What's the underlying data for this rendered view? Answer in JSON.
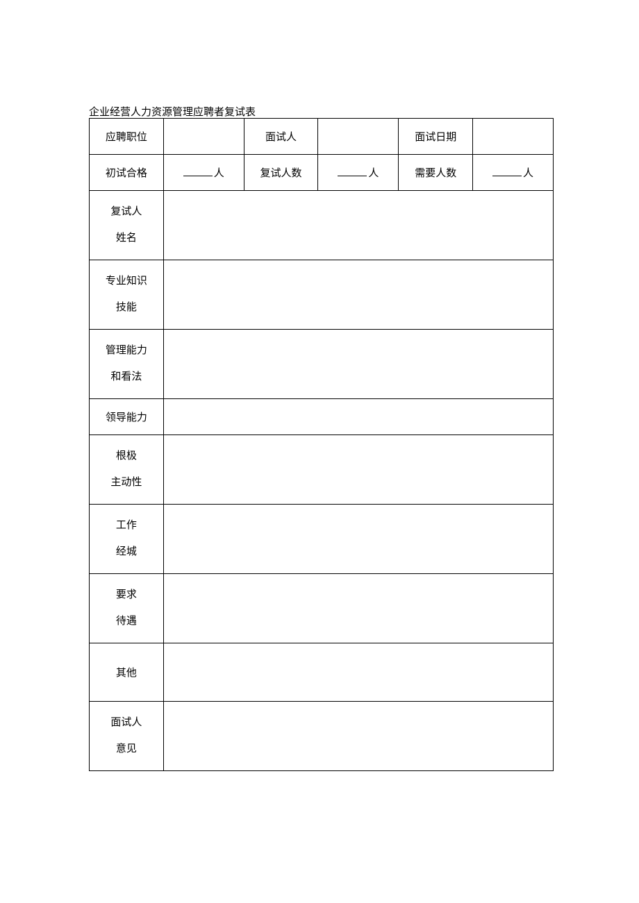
{
  "title": "企业经营人力资源管理应聘者复试表",
  "header": {
    "positionLabel": "应聘职位",
    "positionValue": "",
    "interviewerLabel": "面试人",
    "interviewerValue": "",
    "dateLabel": "面试日期",
    "dateValue": ""
  },
  "counts": {
    "firstPassLabel": "初试合格",
    "retestCountLabel": "复试人数",
    "neededCountLabel": "需要人数",
    "unit": "人"
  },
  "rows": {
    "candidateName": {
      "line1": "复试人",
      "line2": "姓名"
    },
    "professionalSkill": {
      "line1": "专业知识",
      "line2": "技能"
    },
    "managementAbility": {
      "line1": "管理能力",
      "line2": "和看法"
    },
    "leadership": {
      "line1": "领导能力"
    },
    "initiative": {
      "line1": "根极",
      "line2": "主动性"
    },
    "workExperience": {
      "line1": "工作",
      "line2": "经城"
    },
    "requirements": {
      "line1": "要求",
      "line2": "待遇"
    },
    "other": {
      "line1": "其他"
    },
    "interviewerOpinion": {
      "line1": "面试人",
      "line2": "意见"
    }
  }
}
